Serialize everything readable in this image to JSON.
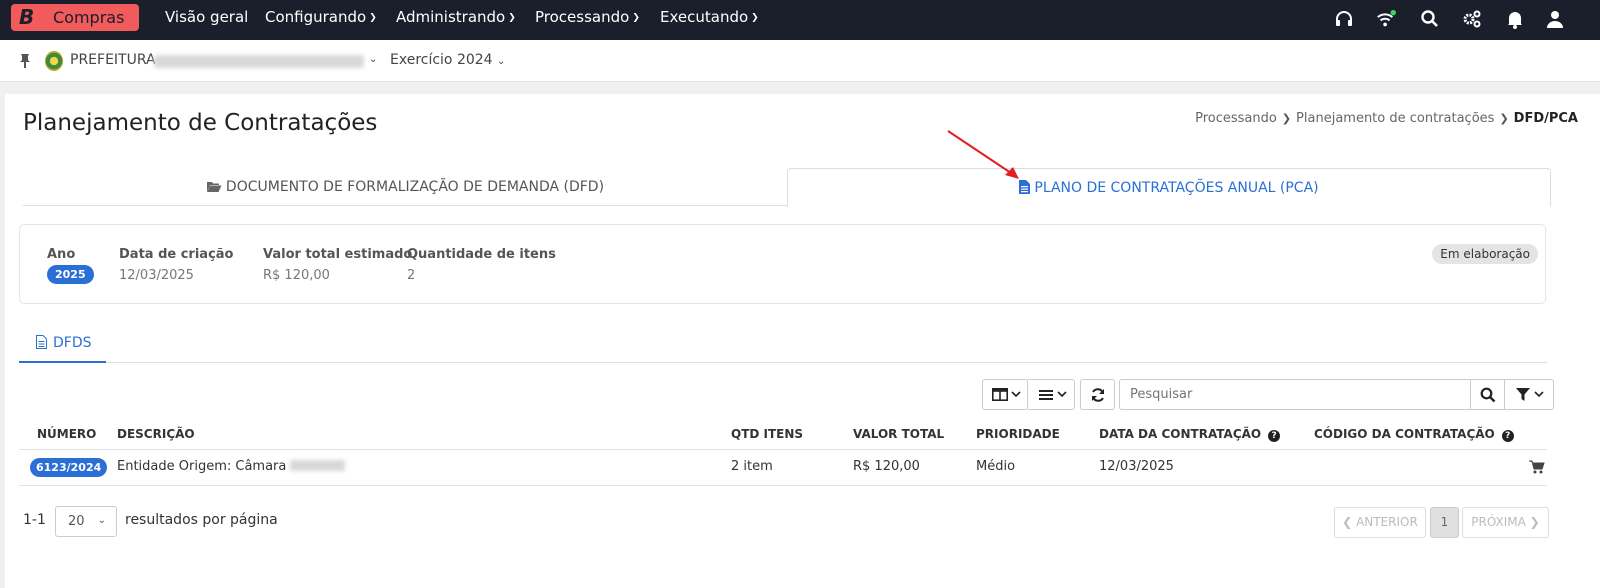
{
  "app": {
    "brand_letter": "B",
    "brand_name": "Compras"
  },
  "nav": {
    "items": [
      {
        "label": "Visão geral",
        "has_caret": false
      },
      {
        "label": "Configurando",
        "has_caret": true
      },
      {
        "label": "Administrando",
        "has_caret": true
      },
      {
        "label": "Processando",
        "has_caret": true
      },
      {
        "label": "Executando",
        "has_caret": true
      }
    ],
    "icons": [
      "headset-icon",
      "wifi-icon",
      "search-icon",
      "gears-icon",
      "bell-icon",
      "user-icon"
    ]
  },
  "context": {
    "org_prefix": "PREFEITURA",
    "exercise": "Exercício 2024"
  },
  "page": {
    "title": "Planejamento de Contratações",
    "breadcrumb": [
      "Processando",
      "Planejamento de contratações",
      "DFD/PCA"
    ]
  },
  "tabs": {
    "dfd": "DOCUMENTO DE FORMALIZAÇÃO DE DEMANDA (DFD)",
    "pca": "PLANO DE CONTRATAÇÕES ANUAL (PCA)"
  },
  "summary": {
    "year_label": "Ano",
    "year_value": "2025",
    "created_label": "Data de criação",
    "created_value": "12/03/2025",
    "total_label": "Valor total estimado",
    "total_value": "R$ 120,00",
    "qty_label": "Quantidade de itens",
    "qty_value": "2",
    "status": "Em elaboração"
  },
  "subtab": {
    "label": "DFDS"
  },
  "search": {
    "placeholder": "Pesquisar"
  },
  "table": {
    "headers": {
      "numero": "NÚMERO",
      "descricao": "DESCRIÇÃO",
      "qtd": "QTD ITENS",
      "valor": "VALOR TOTAL",
      "prioridade": "PRIORIDADE",
      "data": "DATA DA CONTRATAÇÃO",
      "codigo": "CÓDIGO DA CONTRATAÇÃO"
    },
    "rows": [
      {
        "numero": "6123/2024",
        "descricao": "Entidade Origem: Câmara",
        "qtd": "2 item",
        "valor": "R$ 120,00",
        "prioridade": "Médio",
        "data": "12/03/2025",
        "codigo": ""
      }
    ]
  },
  "pagination": {
    "range": "1-1",
    "per_page": "20",
    "per_page_label": "resultados por página",
    "prev": "ANTERIOR",
    "current": "1",
    "next": "PRÓXIMA"
  },
  "colors": {
    "topbar": "#1b1e2b",
    "brand": "#f15b5b",
    "accent": "#2a6fd6",
    "arrow": "#e02020"
  }
}
